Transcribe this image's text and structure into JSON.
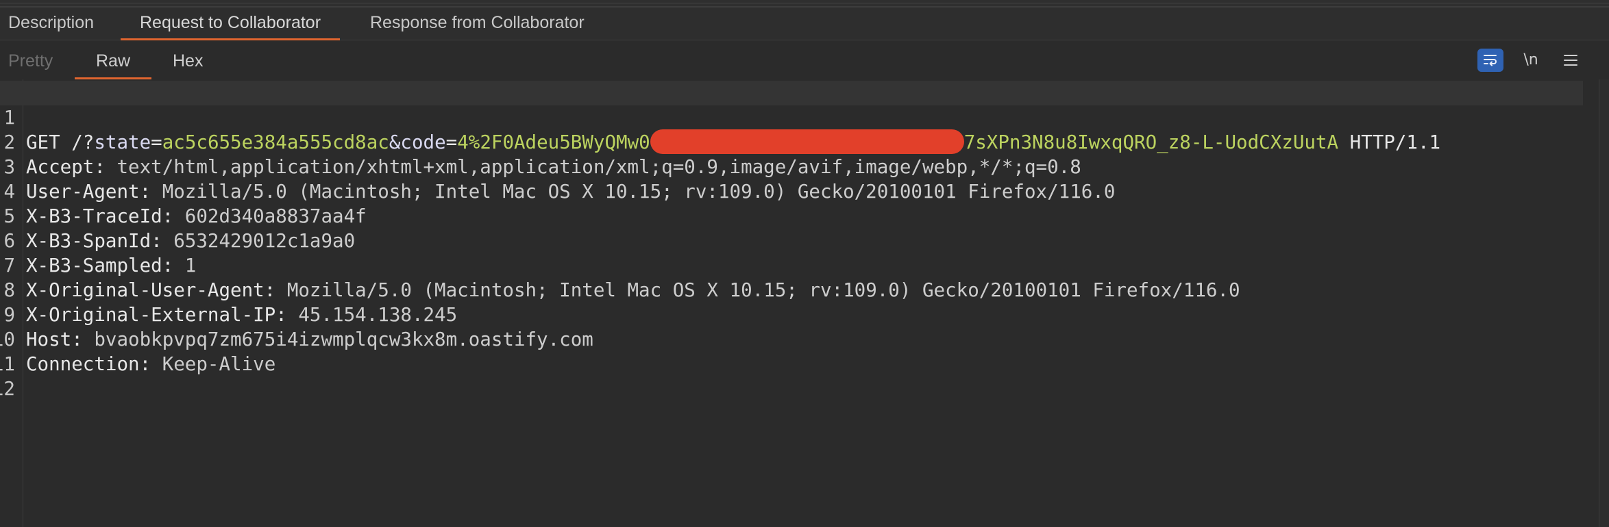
{
  "tabs": [
    {
      "label": "Description"
    },
    {
      "label": "Request to Collaborator"
    },
    {
      "label": "Response from Collaborator"
    }
  ],
  "subtabs": [
    {
      "label": "Pretty"
    },
    {
      "label": "Raw"
    },
    {
      "label": "Hex"
    }
  ],
  "toolbar": {
    "wrap_icon": "word-wrap-icon",
    "newline_label": "\\n",
    "menu_icon": "hamburger-menu-icon"
  },
  "colors": {
    "accent": "#e0652f",
    "wrap_button": "#2f62b3",
    "param_value": "#bcd35f",
    "redaction": "#e2402a"
  },
  "request": {
    "line1": {
      "number": "1",
      "method": "GET",
      "path": "/?",
      "p1_name": "state",
      "p1_value": "ac5c655e384a555cd8ac",
      "amp": "&",
      "p2_name": "code",
      "p2_value_start": "4%2F0Adeu5BWyQMw0",
      "p2_value_end": "7sXPn3N8u8IwxqQRO_z8-L-UodCXzUutA",
      "protocol": "HTTP/1.1"
    },
    "headers": [
      {
        "number": "2",
        "name": "Accept:",
        "value": "text/html,application/xhtml+xml,application/xml;q=0.9,image/avif,image/webp,*/*;q=0.8"
      },
      {
        "number": "3",
        "name": "User-Agent:",
        "value": "Mozilla/5.0 (Macintosh; Intel Mac OS X 10.15; rv:109.0) Gecko/20100101 Firefox/116.0"
      },
      {
        "number": "4",
        "name": "X-B3-TraceId:",
        "value": "602d340a8837aa4f"
      },
      {
        "number": "5",
        "name": "X-B3-SpanId:",
        "value": "6532429012c1a9a0"
      },
      {
        "number": "6",
        "name": "X-B3-Sampled:",
        "value": "1"
      },
      {
        "number": "7",
        "name": "X-Original-User-Agent:",
        "value": "Mozilla/5.0 (Macintosh; Intel Mac OS X 10.15; rv:109.0) Gecko/20100101 Firefox/116.0"
      },
      {
        "number": "8",
        "name": "X-Original-External-IP:",
        "value": "45.154.138.245"
      },
      {
        "number": "9",
        "name": "Host:",
        "value": "bvaobkpvpq7zm675i4izwmplqcw3kx8m.oastify.com"
      },
      {
        "number": "10",
        "name": "Connection:",
        "value": "Keep-Alive"
      }
    ],
    "empty_lines": [
      "11",
      "12"
    ]
  }
}
